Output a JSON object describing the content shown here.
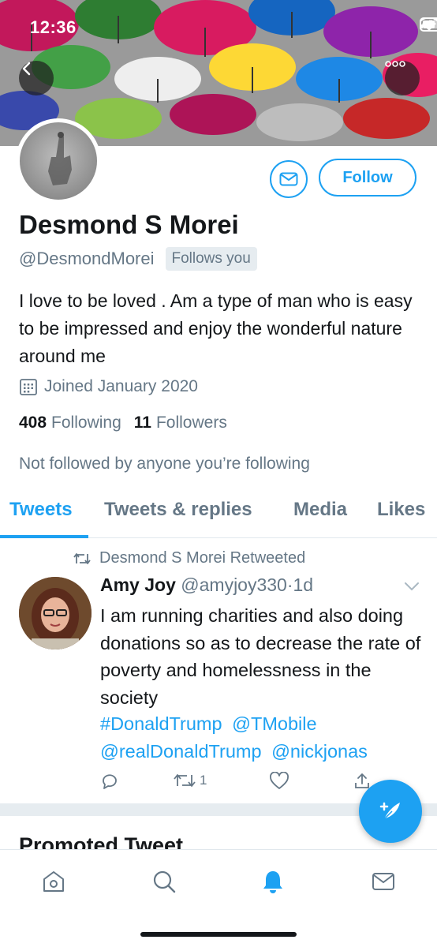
{
  "status_bar": {
    "time": "12:36"
  },
  "profile": {
    "display_name": "Desmond S Morei",
    "handle": "@DesmondMorei",
    "follows_you_badge": "Follows you",
    "bio": "I love to be loved . Am a type of man who is easy to be impressed and enjoy the wonderful nature around me",
    "joined": "Joined January 2020",
    "following_count": "408",
    "following_label": "Following",
    "followers_count": "11",
    "followers_label": "Followers",
    "not_followed_note": "Not followed by anyone you’re following",
    "follow_button_label": "Follow"
  },
  "tabs": [
    {
      "label": "Tweets",
      "active": true
    },
    {
      "label": "Tweets & replies",
      "active": false
    },
    {
      "label": "Media",
      "active": false
    },
    {
      "label": "Likes",
      "active": false
    }
  ],
  "tweet": {
    "retweet_note": "Desmond S Morei Retweeted",
    "author_name": "Amy Joy",
    "author_handle_time": "@amyjoy330·1d",
    "text": "I am running charities and also doing donations so as to decrease the rate of poverty and homelessness in the society",
    "links": [
      "#DonaldTrump",
      "@TMobile",
      "@realDonaldTrump",
      "@nickjonas"
    ],
    "retweet_count": "1"
  },
  "promoted": {
    "title": "Promoted Tweet"
  },
  "colors": {
    "accent": "#1da1f2",
    "secondary_text": "#657786",
    "primary_text": "#14171a"
  },
  "icons": {
    "bottom_nav": [
      "home-icon",
      "search-icon",
      "notifications-bell-icon",
      "messages-envelope-icon"
    ],
    "tweet_actions": [
      "reply-icon",
      "retweet-icon",
      "like-heart-icon",
      "share-icon"
    ]
  }
}
